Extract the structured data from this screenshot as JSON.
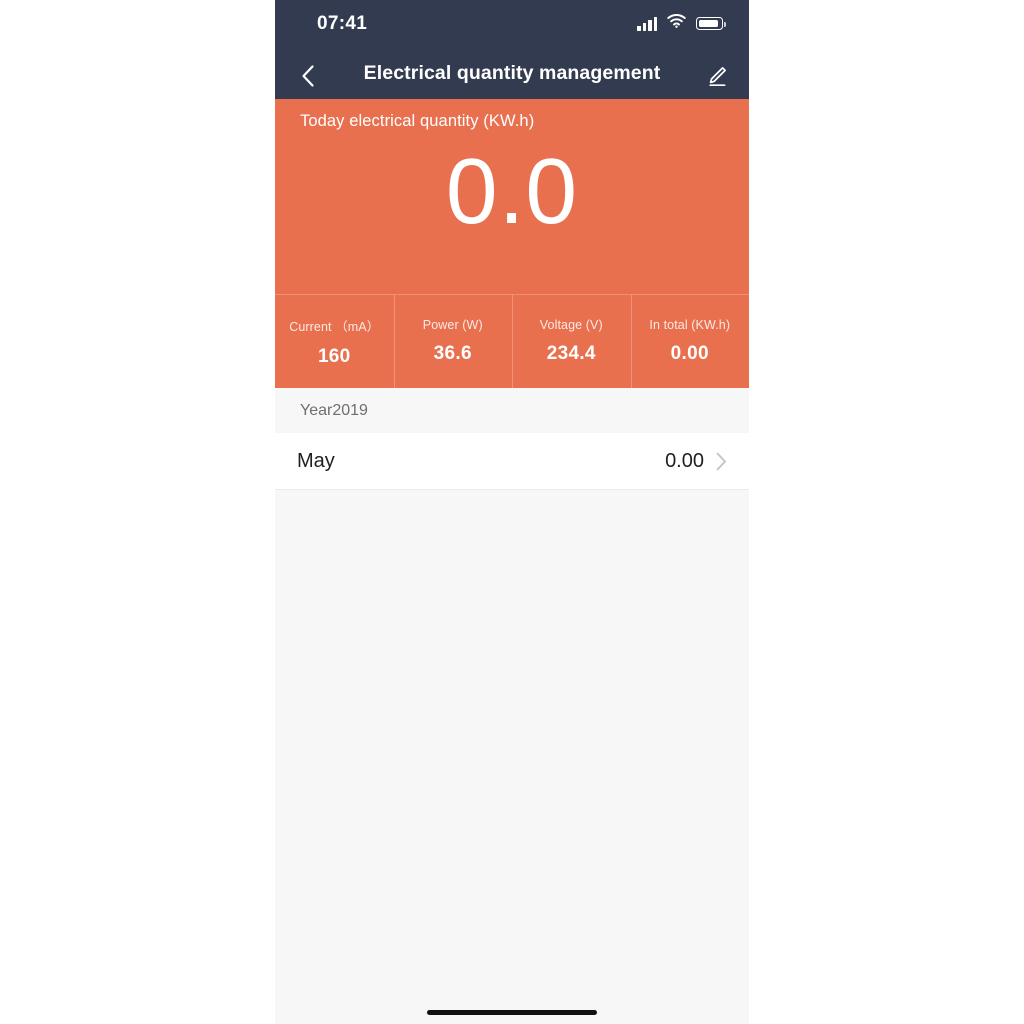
{
  "status_bar": {
    "time": "07:41",
    "icons": {
      "signal": "signal-bars-icon",
      "wifi": "wifi-icon",
      "battery": "battery-icon"
    }
  },
  "nav": {
    "title": "Electrical quantity management",
    "back_icon": "chevron-left-icon",
    "edit_icon": "edit-pencil-icon"
  },
  "hero": {
    "label": "Today electrical quantity (KW.h)",
    "value": "0.0",
    "background_color": "#e8704f"
  },
  "stats": [
    {
      "label": "Current （mA）",
      "value": "160"
    },
    {
      "label": "Power (W)",
      "value": "36.6"
    },
    {
      "label": "Voltage (V)",
      "value": "234.4"
    },
    {
      "label": "In total (KW.h)",
      "value": "0.00"
    }
  ],
  "history": {
    "section_header": "Year2019",
    "rows": [
      {
        "month": "May",
        "value": "0.00",
        "chevron_icon": "chevron-right-icon"
      }
    ]
  },
  "theme": {
    "header_color": "#323b4f",
    "accent_color": "#e8704f",
    "page_background": "#f7f7f7"
  }
}
